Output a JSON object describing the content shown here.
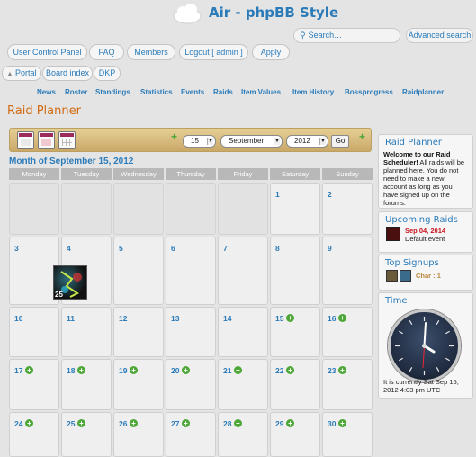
{
  "site": {
    "title": "Air - phpBB Style"
  },
  "search": {
    "placeholder": "Search…",
    "advanced_label": "Advanced search"
  },
  "top_nav": {
    "ucp": "User Control Panel",
    "faq": "FAQ",
    "members": "Members",
    "logout": "Logout [ admin ]",
    "apply": "Apply"
  },
  "breadcrumbs": [
    "Portal",
    "Board index",
    "DKP"
  ],
  "sub_nav": [
    "News",
    "Roster",
    "Standings",
    "Statistics",
    "Events",
    "Raids",
    "Item Values",
    "Item History",
    "Bossprogress",
    "Raidplanner"
  ],
  "page": {
    "heading": "Raid Planner"
  },
  "toolbar": {
    "day_value": "15",
    "month_value": "September",
    "year_value": "2012",
    "go_label": "Go",
    "add_symbol": "+"
  },
  "calendar": {
    "title": "Month of September 15, 2012",
    "weekdays": [
      "Monday",
      "Tuesday",
      "Wednesday",
      "Thursday",
      "Friday",
      "Saturday",
      "Sunday"
    ],
    "weeks": [
      [
        "",
        "",
        "",
        "",
        "",
        "1",
        "2"
      ],
      [
        "3",
        "4",
        "5",
        "6",
        "7",
        "8",
        "9"
      ],
      [
        "10",
        "11",
        "12",
        "13",
        "14",
        "15",
        "16"
      ],
      [
        "17",
        "18",
        "19",
        "20",
        "21",
        "22",
        "23"
      ],
      [
        "24",
        "25",
        "26",
        "27",
        "28",
        "29",
        "30"
      ]
    ],
    "event_day_label": "25"
  },
  "sidebar": {
    "raid_planner": {
      "title": "Raid Planner",
      "welcome_bold": "Welcome to our Raid Scheduler!",
      "welcome_text": " All raids will be planned here. You do not need to make a new account as long as you have signed up on the forums."
    },
    "upcoming": {
      "title": "Upcoming Raids",
      "date": "Sep 04, 2014",
      "event": "Default event"
    },
    "top_signups": {
      "title": "Top Signups",
      "entry": "Char : 1"
    },
    "time": {
      "title": "Time",
      "text": "It is currently Sat Sep 15, 2012 4:03 pm UTC"
    }
  }
}
